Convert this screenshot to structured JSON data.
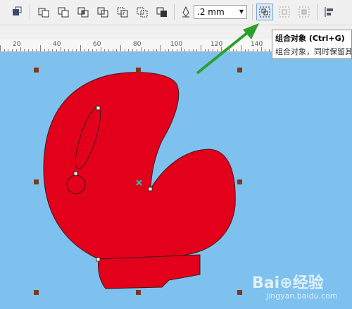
{
  "toolbar": {
    "buttons": [
      {
        "icon": "arrange-icon"
      },
      {
        "icon": "weld-icon"
      },
      {
        "icon": "trim-icon"
      },
      {
        "icon": "intersect-icon"
      },
      {
        "icon": "simplify-icon"
      },
      {
        "icon": "front-minus-back-icon"
      },
      {
        "icon": "back-minus-front-icon"
      },
      {
        "icon": "create-boundary-icon"
      }
    ],
    "outline_width": ".2 mm",
    "group_icon": "group-objects-icon",
    "ungroup_icon": "ungroup-icon",
    "ungroup_all_icon": "ungroup-all-icon",
    "align_icon": "align-distribute-icon"
  },
  "ruler": {
    "labels": [
      "20",
      "40",
      "60",
      "80",
      "100",
      "120",
      "140"
    ]
  },
  "tooltip": {
    "title": "组合对象 (Ctrl+G)",
    "body": "组合对象，同时保留其"
  },
  "watermark": {
    "brand": "Bai⊕经验",
    "url": "jingyan.baidu.com"
  },
  "colors": {
    "canvas": "#7fc1ee",
    "shape_fill": "#e3001b",
    "arrow": "#2aa02a",
    "handle": "#7b3a1d"
  }
}
